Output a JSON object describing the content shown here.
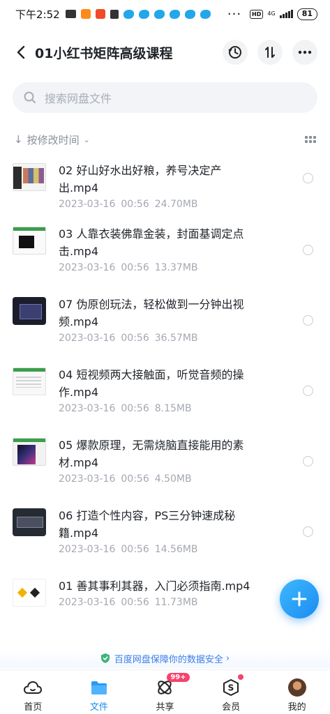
{
  "status_bar": {
    "time": "下午2:52",
    "hd": "HD",
    "network": "4G",
    "battery": "81"
  },
  "header": {
    "title": "01小红书矩阵高级课程"
  },
  "search": {
    "placeholder": "搜索网盘文件"
  },
  "sort": {
    "label": "按修改时间"
  },
  "files": [
    {
      "name": "02 好山好水出好粮，养号决定产出.mp4",
      "date": "2023-03-16",
      "time": "00:56",
      "size": "24.70MB"
    },
    {
      "name": "03 人靠衣装佛靠金装，封面基调定点击.mp4",
      "date": "2023-03-16",
      "time": "00:56",
      "size": "13.37MB"
    },
    {
      "name": "07 伪原创玩法，轻松做到一分钟出视频.mp4",
      "date": "2023-03-16",
      "time": "00:56",
      "size": "36.57MB"
    },
    {
      "name": "04 短视频两大接触面，听觉音频的操作.mp4",
      "date": "2023-03-16",
      "time": "00:56",
      "size": "8.15MB"
    },
    {
      "name": "05 爆款原理，无需烧脑直接能用的素材.mp4",
      "date": "2023-03-16",
      "time": "00:56",
      "size": "4.50MB"
    },
    {
      "name": "06 打造个性内容，PS三分钟速成秘籍.mp4",
      "date": "2023-03-16",
      "time": "00:56",
      "size": "14.56MB"
    },
    {
      "name": "01 善其事利其器，入门必须指南.mp4",
      "date": "2023-03-16",
      "time": "00:56",
      "size": "11.73MB"
    }
  ],
  "security_notice": "百度网盘保障你的数据安全",
  "nav": {
    "home": "首页",
    "files": "文件",
    "share": "共享",
    "share_badge": "99+",
    "vip": "会员",
    "mine": "我的"
  },
  "colors": {
    "accent": "#1a8cf0",
    "badge": "#f5436b"
  }
}
